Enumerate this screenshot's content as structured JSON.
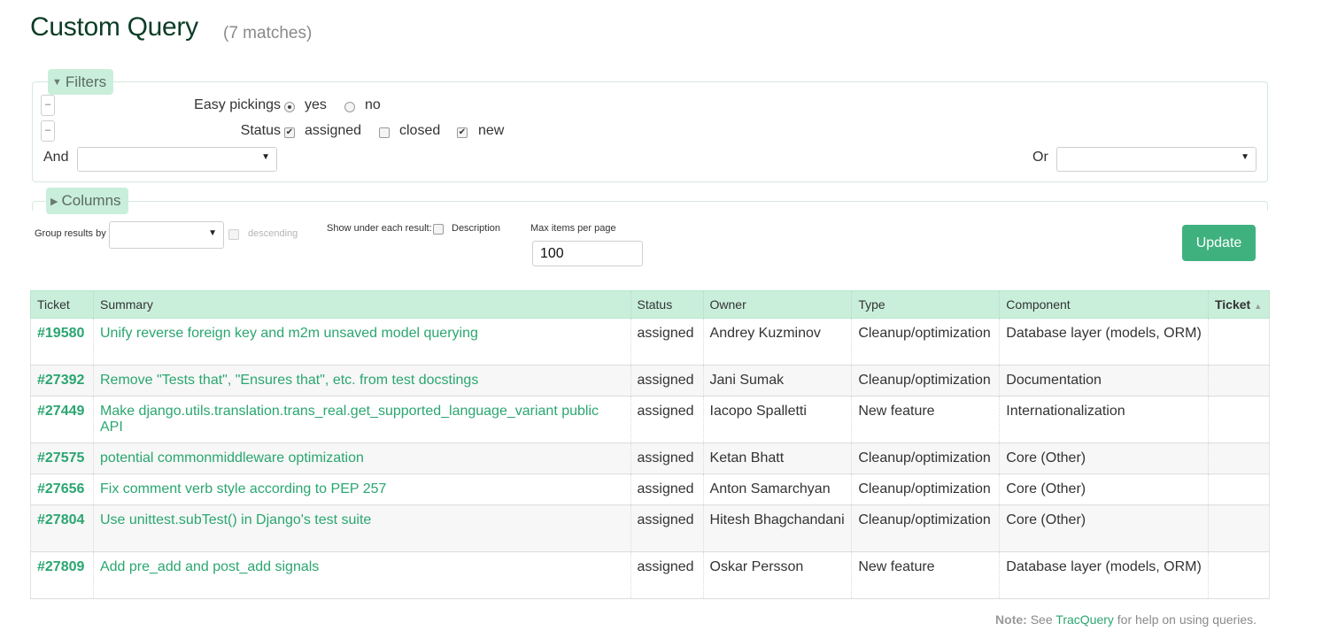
{
  "header": {
    "title": "Custom Query",
    "matches": "(7 matches)"
  },
  "filters": {
    "legend": "Filters",
    "easy_pickings": {
      "label": "Easy pickings",
      "options": [
        "yes",
        "no"
      ],
      "selected": "yes"
    },
    "status": {
      "label": "Status",
      "options": [
        {
          "label": "assigned",
          "checked": true
        },
        {
          "label": "closed",
          "checked": false
        },
        {
          "label": "new",
          "checked": true
        }
      ]
    },
    "and_label": "And",
    "or_label": "Or",
    "remove_label": "–"
  },
  "columns": {
    "legend": "Columns"
  },
  "options": {
    "group_by_label": "Group results by",
    "descending_label": "descending",
    "show_under_label": "Show under each result:",
    "description_label": "Description",
    "max_items_label": "Max items per page",
    "max_items_value": "100",
    "update_label": "Update"
  },
  "table": {
    "headers": [
      "Ticket",
      "Summary",
      "Status",
      "Owner",
      "Type",
      "Component",
      "Ticket"
    ],
    "sort_indicator": "▲",
    "rows": [
      {
        "ticket": "#19580",
        "summary": "Unify reverse foreign key and m2m unsaved model querying",
        "status": "assigned",
        "owner": "Andrey Kuzminov",
        "type": "Cleanup/optimization",
        "component": "Database layer (models, ORM)"
      },
      {
        "ticket": "#27392",
        "summary": "Remove \"Tests that\", \"Ensures that\", etc. from test docstings",
        "status": "assigned",
        "owner": "Jani Sumak",
        "type": "Cleanup/optimization",
        "component": "Documentation"
      },
      {
        "ticket": "#27449",
        "summary": "Make django.utils.translation.trans_real.get_supported_language_variant public API",
        "status": "assigned",
        "owner": "Iacopo Spalletti",
        "type": "New feature",
        "component": "Internationalization"
      },
      {
        "ticket": "#27575",
        "summary": "potential commonmiddleware optimization",
        "status": "assigned",
        "owner": "Ketan Bhatt",
        "type": "Cleanup/optimization",
        "component": "Core (Other)"
      },
      {
        "ticket": "#27656",
        "summary": "Fix comment verb style according to PEP 257",
        "status": "assigned",
        "owner": "Anton Samarchyan",
        "type": "Cleanup/optimization",
        "component": "Core (Other)"
      },
      {
        "ticket": "#27804",
        "summary": "Use unittest.subTest() in Django's test suite",
        "status": "assigned",
        "owner": "Hitesh Bhagchandani",
        "type": "Cleanup/optimization",
        "component": "Core (Other)"
      },
      {
        "ticket": "#27809",
        "summary": "Add pre_add and post_add signals",
        "status": "assigned",
        "owner": "Oskar Persson",
        "type": "New feature",
        "component": "Database layer (models, ORM)"
      }
    ]
  },
  "footer": {
    "note_label": "Note:",
    "note_see": "See",
    "link": "TracQuery",
    "note_rest": "for help on using queries."
  }
}
